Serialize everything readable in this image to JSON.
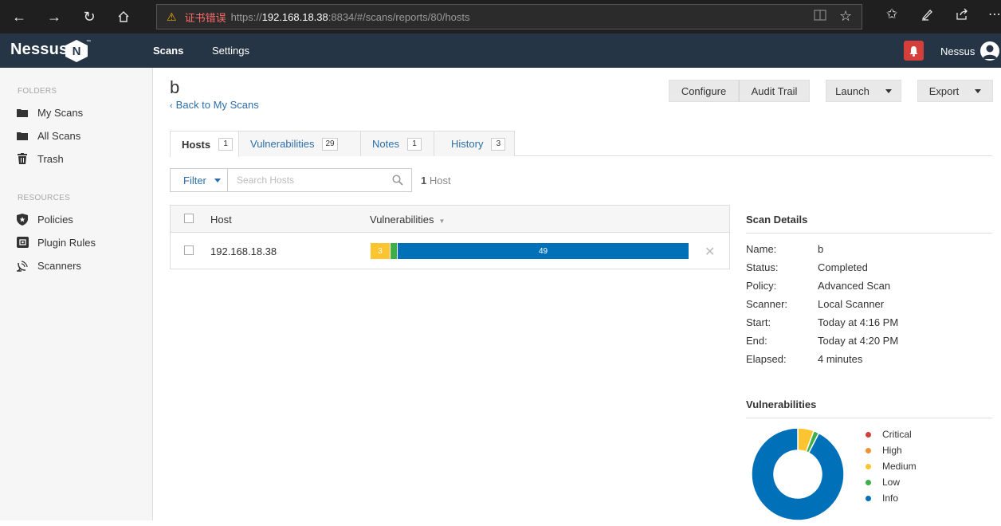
{
  "browser": {
    "cert_warning": "证书错误",
    "url_prefix": "https://",
    "url_host": "192.168.18.38",
    "url_rest": ":8834/#/scans/reports/80/hosts"
  },
  "header": {
    "logo": "Nessus",
    "logo_badge": "N",
    "nav": [
      "Scans",
      "Settings"
    ],
    "user": "Nessus"
  },
  "sidebar": {
    "folders_label": "FOLDERS",
    "folders": [
      "My Scans",
      "All Scans",
      "Trash"
    ],
    "resources_label": "RESOURCES",
    "resources": [
      "Policies",
      "Plugin Rules",
      "Scanners"
    ]
  },
  "main": {
    "title": "b",
    "back_link": "Back to My Scans",
    "buttons": {
      "configure": "Configure",
      "audit_trail": "Audit Trail",
      "launch": "Launch",
      "export": "Export"
    },
    "tabs": [
      {
        "label": "Hosts",
        "count": "1"
      },
      {
        "label": "Vulnerabilities",
        "count": "29"
      },
      {
        "label": "Notes",
        "count": "1"
      },
      {
        "label": "History",
        "count": "3"
      }
    ],
    "filter_label": "Filter",
    "search_placeholder": "Search Hosts",
    "host_count_num": "1",
    "host_count_label": "Host",
    "table": {
      "col_host": "Host",
      "col_vulns": "Vulnerabilities",
      "rows": [
        {
          "host": "192.168.18.38",
          "segments": [
            {
              "severity": "Medium",
              "count": 3,
              "label": "3"
            },
            {
              "severity": "Low",
              "count": 1,
              "label": ""
            },
            {
              "severity": "Info",
              "count": 49,
              "label": "49"
            }
          ]
        }
      ]
    }
  },
  "scan_details": {
    "title": "Scan Details",
    "fields": [
      {
        "key": "Name:",
        "value": "b"
      },
      {
        "key": "Status:",
        "value": "Completed"
      },
      {
        "key": "Policy:",
        "value": "Advanced Scan"
      },
      {
        "key": "Scanner:",
        "value": "Local Scanner"
      },
      {
        "key": "Start:",
        "value": "Today at 4:16 PM"
      },
      {
        "key": "End:",
        "value": "Today at 4:20 PM"
      },
      {
        "key": "Elapsed:",
        "value": "4 minutes"
      }
    ]
  },
  "vulnerabilities": {
    "title": "Vulnerabilities",
    "legend": [
      {
        "label": "Critical",
        "color": "#d43f3a",
        "count": 0
      },
      {
        "label": "High",
        "color": "#ee9336",
        "count": 0
      },
      {
        "label": "Medium",
        "color": "#fdc431",
        "count": 3
      },
      {
        "label": "Low",
        "color": "#3fae49",
        "count": 1
      },
      {
        "label": "Info",
        "color": "#0071b9",
        "count": 49
      }
    ]
  }
}
